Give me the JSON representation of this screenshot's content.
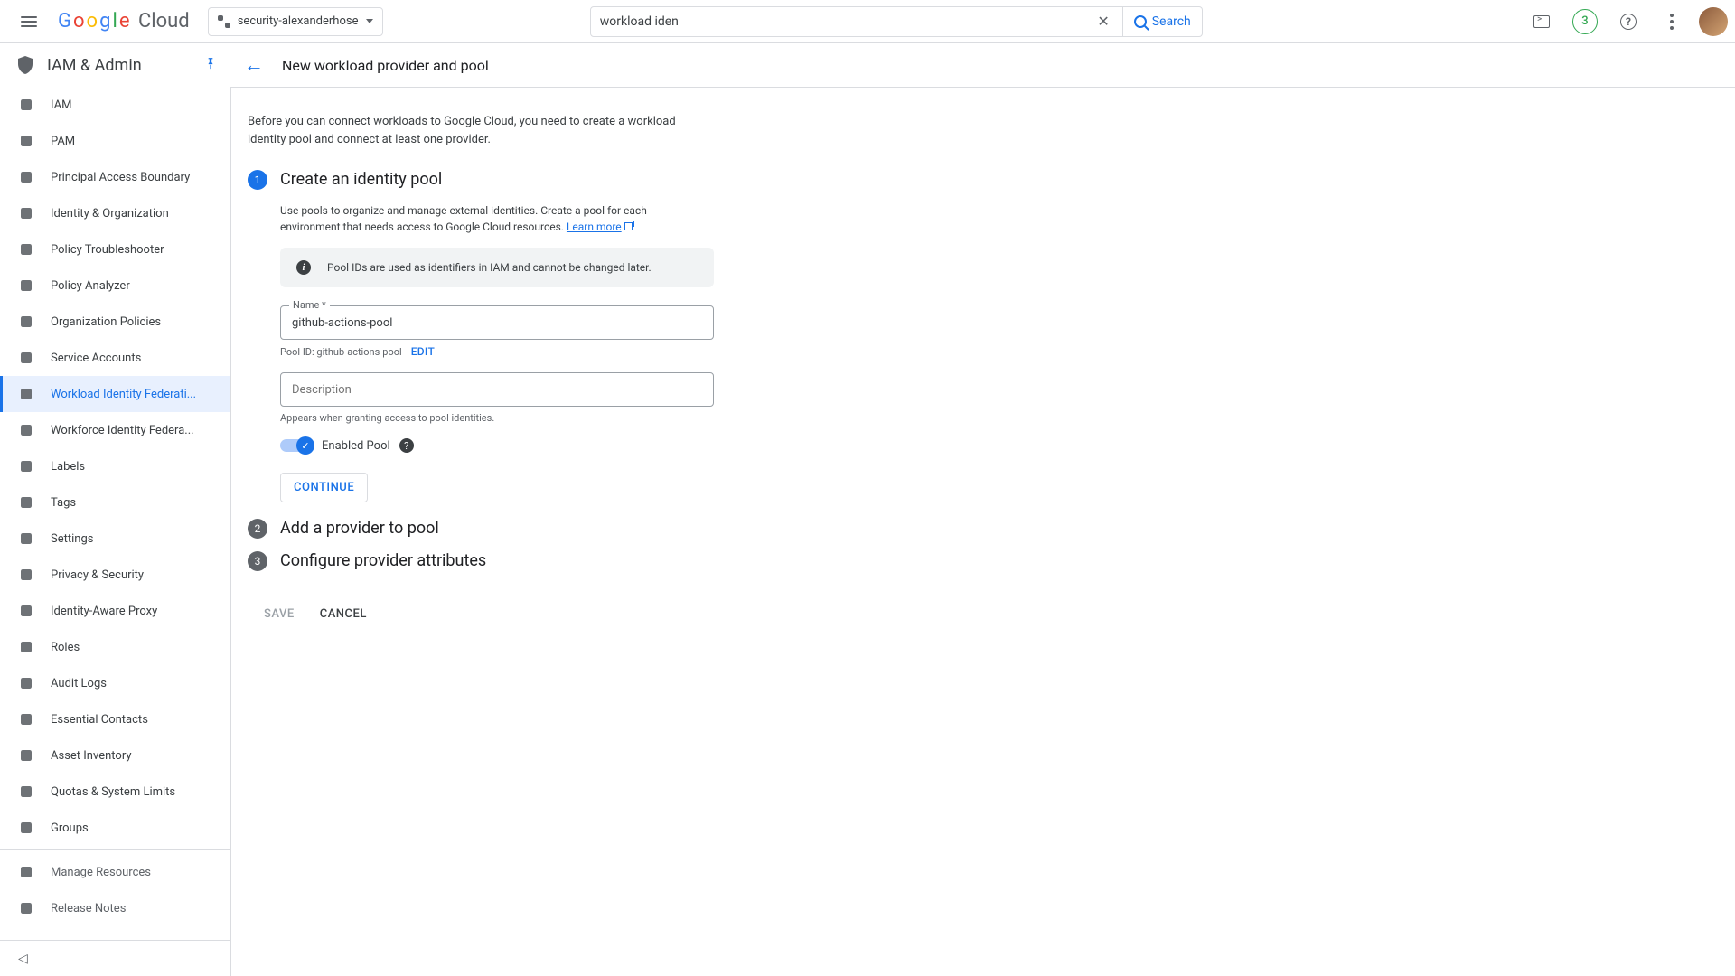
{
  "topbar": {
    "logo_text": "Google Cloud",
    "project_name": "security-alexanderhose",
    "search_value": "workload iden",
    "search_button": "Search",
    "trial_count": "3"
  },
  "product": {
    "name": "IAM & Admin",
    "page_title": "New workload provider and pool"
  },
  "sidebar": {
    "items": [
      {
        "label": "IAM",
        "icon": "iam"
      },
      {
        "label": "PAM",
        "icon": "pam"
      },
      {
        "label": "Principal Access Boundary",
        "icon": "boundary"
      },
      {
        "label": "Identity & Organization",
        "icon": "identity"
      },
      {
        "label": "Policy Troubleshooter",
        "icon": "wrench"
      },
      {
        "label": "Policy Analyzer",
        "icon": "analyzer"
      },
      {
        "label": "Organization Policies",
        "icon": "org"
      },
      {
        "label": "Service Accounts",
        "icon": "service"
      },
      {
        "label": "Workload Identity Federati...",
        "icon": "wif",
        "active": true
      },
      {
        "label": "Workforce Identity Federa...",
        "icon": "workforce"
      },
      {
        "label": "Labels",
        "icon": "labels"
      },
      {
        "label": "Tags",
        "icon": "tags"
      },
      {
        "label": "Settings",
        "icon": "settings"
      },
      {
        "label": "Privacy & Security",
        "icon": "privacy"
      },
      {
        "label": "Identity-Aware Proxy",
        "icon": "iap"
      },
      {
        "label": "Roles",
        "icon": "roles"
      },
      {
        "label": "Audit Logs",
        "icon": "logs"
      },
      {
        "label": "Essential Contacts",
        "icon": "contacts"
      },
      {
        "label": "Asset Inventory",
        "icon": "asset"
      },
      {
        "label": "Quotas & System Limits",
        "icon": "quotas"
      },
      {
        "label": "Groups",
        "icon": "groups"
      }
    ],
    "footer": [
      {
        "label": "Manage Resources"
      },
      {
        "label": "Release Notes"
      }
    ]
  },
  "main": {
    "intro": "Before you can connect workloads to Google Cloud, you need to create a workload identity pool and connect at least one provider.",
    "step1": {
      "title": "Create an identity pool",
      "desc_a": "Use pools to organize and manage external identities. Create a pool for each environment that needs access to Google Cloud resources. ",
      "learn_more": "Learn more",
      "info": "Pool IDs are used as identifiers in IAM and cannot be changed later.",
      "name_label": "Name *",
      "name_value": "github-actions-pool",
      "pool_id_text": "Pool ID: github-actions-pool",
      "edit": "EDIT",
      "desc_placeholder": "Description",
      "desc_hint": "Appears when granting access to pool identities.",
      "enabled_label": "Enabled Pool",
      "continue": "CONTINUE"
    },
    "step2": {
      "title": "Add a provider to pool"
    },
    "step3": {
      "title": "Configure provider attributes"
    },
    "footer": {
      "save": "SAVE",
      "cancel": "CANCEL"
    }
  }
}
